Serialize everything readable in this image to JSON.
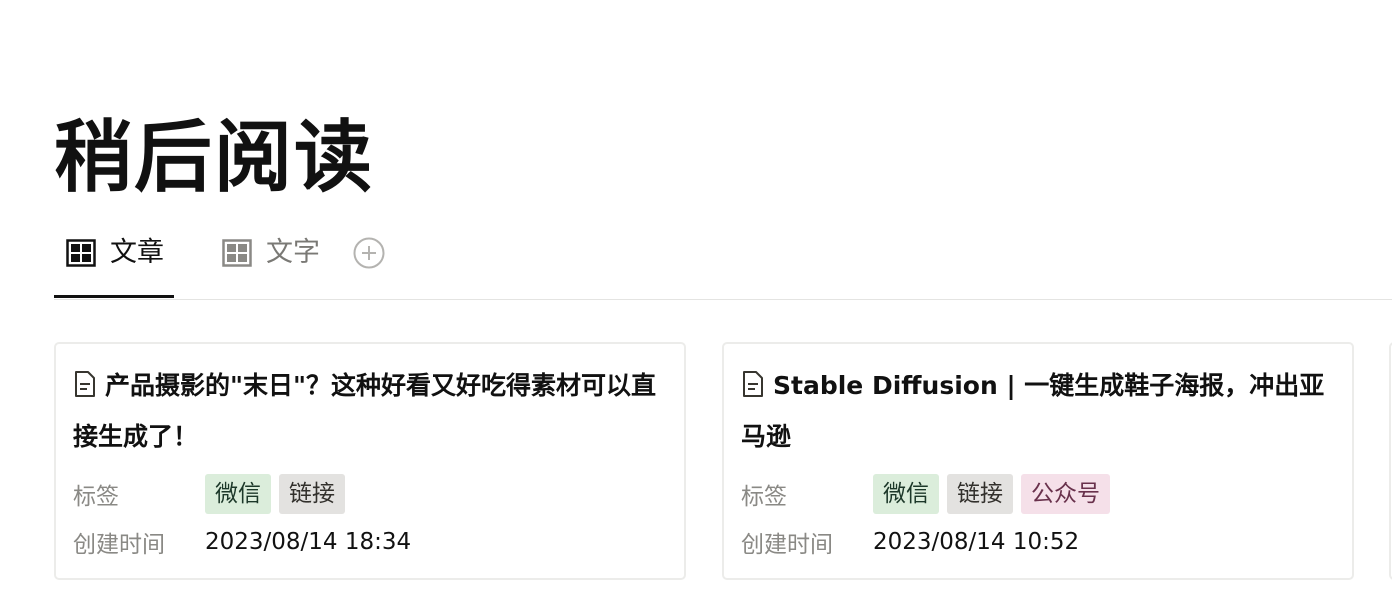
{
  "page": {
    "title": "稍后阅读"
  },
  "tabs": [
    {
      "label": "文章",
      "icon": "table-grid-icon",
      "active": true
    },
    {
      "label": "文字",
      "icon": "table-grid-icon",
      "active": false
    }
  ],
  "add_view_icon": "plus-circle-icon",
  "cards": [
    {
      "icon": "document-icon",
      "title": "产品摄影的\"末日\"？这种好看又好吃得素材可以直接生成了！",
      "tags_label": "标签",
      "tags": [
        {
          "text": "微信",
          "bg": "#dbeddb",
          "fg": "#1c3829"
        },
        {
          "text": "链接",
          "bg": "#e3e2e0",
          "fg": "#32302c"
        }
      ],
      "created_label": "创建时间",
      "created_value": "2023/08/14 18:34"
    },
    {
      "icon": "document-icon",
      "title": "Stable Diffusion | 一键生成鞋子海报，冲出亚马逊",
      "tags_label": "标签",
      "tags": [
        {
          "text": "微信",
          "bg": "#dbeddb",
          "fg": "#1c3829"
        },
        {
          "text": "链接",
          "bg": "#e3e2e0",
          "fg": "#32302c"
        },
        {
          "text": "公众号",
          "bg": "#f5e0e9",
          "fg": "#69314c"
        }
      ],
      "created_label": "创建时间",
      "created_value": "2023/08/14 10:52"
    }
  ]
}
